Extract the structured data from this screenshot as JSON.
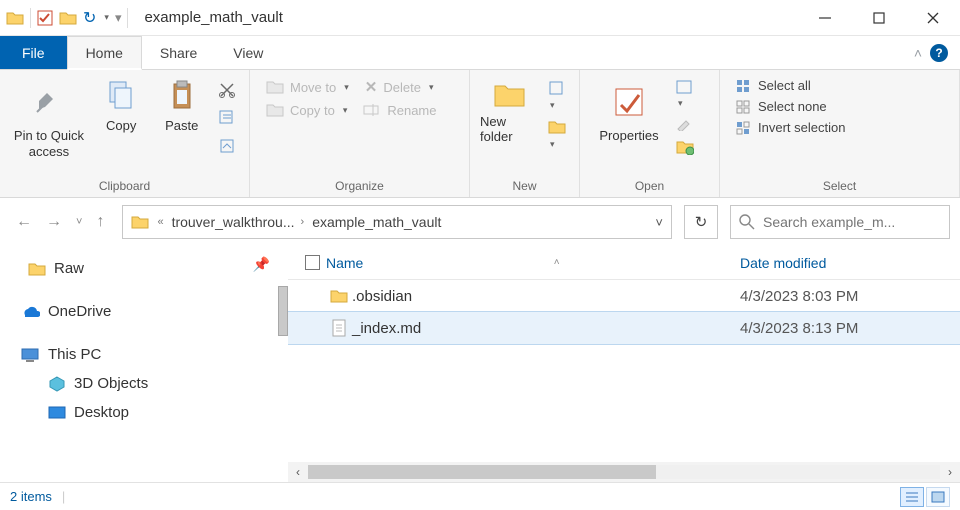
{
  "title": "example_math_vault",
  "tabs": {
    "file": "File",
    "home": "Home",
    "share": "Share",
    "view": "View"
  },
  "ribbon": {
    "clipboard": {
      "title": "Clipboard",
      "pin": "Pin to Quick access",
      "copy": "Copy",
      "paste": "Paste"
    },
    "organize": {
      "title": "Organize",
      "moveto": "Move to",
      "copyto": "Copy to",
      "delete": "Delete",
      "rename": "Rename"
    },
    "new": {
      "title": "New",
      "newfolder": "New folder"
    },
    "open": {
      "title": "Open",
      "properties": "Properties"
    },
    "select": {
      "title": "Select",
      "all": "Select all",
      "none": "Select none",
      "invert": "Invert selection"
    }
  },
  "breadcrumb": {
    "seg1": "trouver_walkthrou...",
    "seg2": "example_math_vault"
  },
  "search": {
    "placeholder": "Search example_m..."
  },
  "columns": {
    "name": "Name",
    "date": "Date modified"
  },
  "nav": {
    "raw": "Raw",
    "onedrive": "OneDrive",
    "thispc": "This PC",
    "threedobjects": "3D Objects",
    "desktop": "Desktop"
  },
  "files": [
    {
      "name": ".obsidian",
      "type": "folder",
      "date": "4/3/2023 8:03 PM",
      "selected": false
    },
    {
      "name": "_index.md",
      "type": "file",
      "date": "4/3/2023 8:13 PM",
      "selected": true
    }
  ],
  "status": {
    "count": "2 items"
  }
}
